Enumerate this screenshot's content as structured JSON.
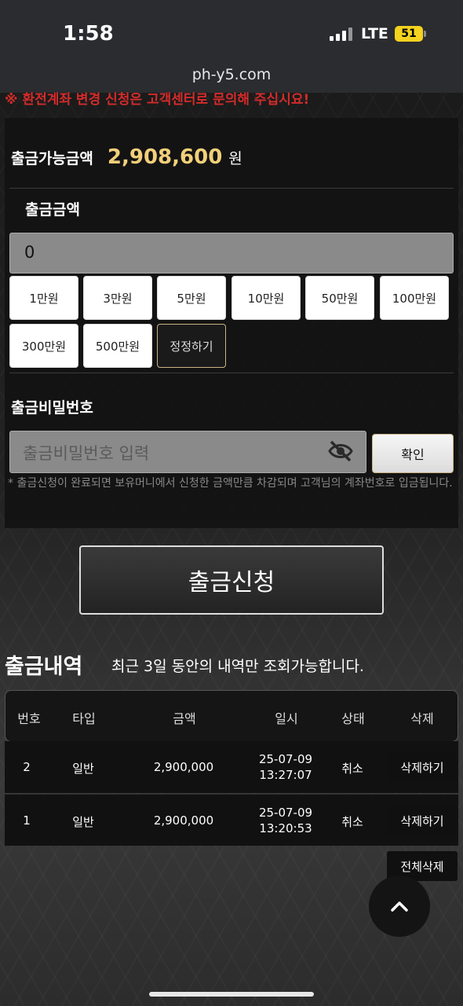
{
  "status_bar": {
    "time": "1:58",
    "network": "LTE",
    "battery": "51"
  },
  "browser": {
    "url": "ph-y5.com"
  },
  "notice_top": "※ 환전계좌 변경 신청은 고객센터로 문의해 주십시요!",
  "withdraw": {
    "available_label": "출금가능금액",
    "available_amount": "2,908,600",
    "currency": "원",
    "amount_label": "출금금액",
    "amount_value": "0",
    "quick_amounts": [
      "1만원",
      "3만원",
      "5만원",
      "10만원",
      "50만원",
      "100만원",
      "300만원",
      "500만원"
    ],
    "reset_label": "정정하기",
    "password_label": "출금비밀번호",
    "password_placeholder": "출금비밀번호 입력",
    "confirm_label": "확인",
    "note": "* 출금신청이 완료되면 보유머니에서 신청한 금액만큼 차감되며 고객님의 계좌번호로 입금됩니다.",
    "submit_label": "출금신청"
  },
  "history": {
    "title": "출금내역",
    "subtitle": "최근 3일 동안의 내역만 조회가능합니다.",
    "columns": [
      "번호",
      "타입",
      "금액",
      "일시",
      "상태",
      "삭제"
    ],
    "rows": [
      {
        "no": "2",
        "type": "일반",
        "amount": "2,900,000",
        "date": "25-07-09",
        "time": "13:27:07",
        "status": "취소",
        "delete": "삭제하기"
      },
      {
        "no": "1",
        "type": "일반",
        "amount": "2,900,000",
        "date": "25-07-09",
        "time": "13:20:53",
        "status": "취소",
        "delete": "삭제하기"
      }
    ],
    "delete_all_label": "전체삭제"
  },
  "icons": {
    "eye": "eye-slash-icon",
    "scroll_top": "chevron-up-icon"
  }
}
